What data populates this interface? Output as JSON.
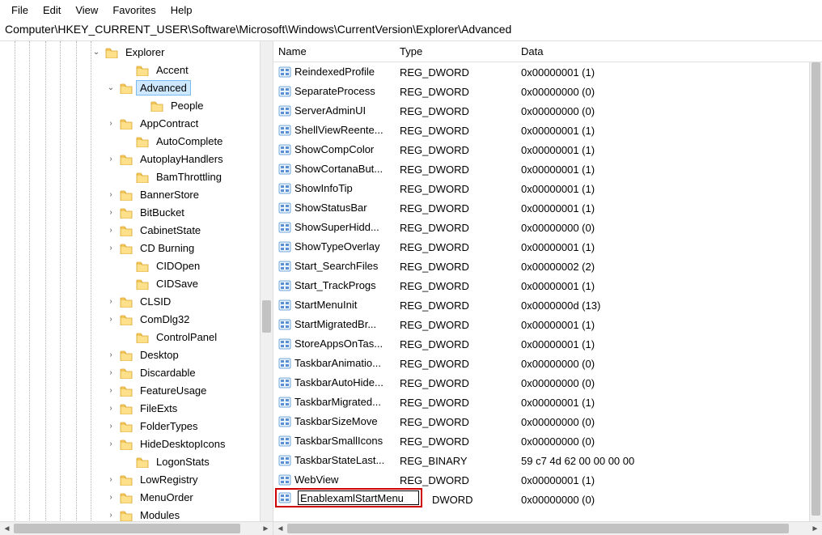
{
  "menu": {
    "items": [
      "File",
      "Edit",
      "View",
      "Favorites",
      "Help"
    ]
  },
  "address": "Computer\\HKEY_CURRENT_USER\\Software\\Microsoft\\Windows\\CurrentVersion\\Explorer\\Advanced",
  "tree": {
    "guides": [
      18,
      36,
      56,
      74,
      94,
      112
    ],
    "items": [
      {
        "indent": 112,
        "exp": "v",
        "label": "Explorer",
        "sel": false
      },
      {
        "indent": 150,
        "exp": "",
        "label": "Accent",
        "sel": false
      },
      {
        "indent": 130,
        "exp": "v",
        "label": "Advanced",
        "sel": true
      },
      {
        "indent": 168,
        "exp": "",
        "label": "People",
        "sel": false
      },
      {
        "indent": 130,
        "exp": ">",
        "label": "AppContract",
        "sel": false
      },
      {
        "indent": 150,
        "exp": "",
        "label": "AutoComplete",
        "sel": false
      },
      {
        "indent": 130,
        "exp": ">",
        "label": "AutoplayHandlers",
        "sel": false
      },
      {
        "indent": 150,
        "exp": "",
        "label": "BamThrottling",
        "sel": false
      },
      {
        "indent": 130,
        "exp": ">",
        "label": "BannerStore",
        "sel": false
      },
      {
        "indent": 130,
        "exp": ">",
        "label": "BitBucket",
        "sel": false
      },
      {
        "indent": 130,
        "exp": ">",
        "label": "CabinetState",
        "sel": false
      },
      {
        "indent": 130,
        "exp": ">",
        "label": "CD Burning",
        "sel": false
      },
      {
        "indent": 150,
        "exp": "",
        "label": "CIDOpen",
        "sel": false
      },
      {
        "indent": 150,
        "exp": "",
        "label": "CIDSave",
        "sel": false
      },
      {
        "indent": 130,
        "exp": ">",
        "label": "CLSID",
        "sel": false
      },
      {
        "indent": 130,
        "exp": ">",
        "label": "ComDlg32",
        "sel": false
      },
      {
        "indent": 150,
        "exp": "",
        "label": "ControlPanel",
        "sel": false
      },
      {
        "indent": 130,
        "exp": ">",
        "label": "Desktop",
        "sel": false
      },
      {
        "indent": 130,
        "exp": ">",
        "label": "Discardable",
        "sel": false
      },
      {
        "indent": 130,
        "exp": ">",
        "label": "FeatureUsage",
        "sel": false
      },
      {
        "indent": 130,
        "exp": ">",
        "label": "FileExts",
        "sel": false
      },
      {
        "indent": 130,
        "exp": ">",
        "label": "FolderTypes",
        "sel": false
      },
      {
        "indent": 130,
        "exp": ">",
        "label": "HideDesktopIcons",
        "sel": false
      },
      {
        "indent": 150,
        "exp": "",
        "label": "LogonStats",
        "sel": false
      },
      {
        "indent": 130,
        "exp": ">",
        "label": "LowRegistry",
        "sel": false
      },
      {
        "indent": 130,
        "exp": ">",
        "label": "MenuOrder",
        "sel": false
      },
      {
        "indent": 130,
        "exp": ">",
        "label": "Modules",
        "sel": false
      }
    ]
  },
  "columns": {
    "name": "Name",
    "type": "Type",
    "data": "Data"
  },
  "values": [
    {
      "name": "ReindexedProfile",
      "type": "REG_DWORD",
      "data": "0x00000001 (1)"
    },
    {
      "name": "SeparateProcess",
      "type": "REG_DWORD",
      "data": "0x00000000 (0)"
    },
    {
      "name": "ServerAdminUI",
      "type": "REG_DWORD",
      "data": "0x00000000 (0)"
    },
    {
      "name": "ShellViewReente...",
      "type": "REG_DWORD",
      "data": "0x00000001 (1)"
    },
    {
      "name": "ShowCompColor",
      "type": "REG_DWORD",
      "data": "0x00000001 (1)"
    },
    {
      "name": "ShowCortanaBut...",
      "type": "REG_DWORD",
      "data": "0x00000001 (1)"
    },
    {
      "name": "ShowInfoTip",
      "type": "REG_DWORD",
      "data": "0x00000001 (1)"
    },
    {
      "name": "ShowStatusBar",
      "type": "REG_DWORD",
      "data": "0x00000001 (1)"
    },
    {
      "name": "ShowSuperHidd...",
      "type": "REG_DWORD",
      "data": "0x00000000 (0)"
    },
    {
      "name": "ShowTypeOverlay",
      "type": "REG_DWORD",
      "data": "0x00000001 (1)"
    },
    {
      "name": "Start_SearchFiles",
      "type": "REG_DWORD",
      "data": "0x00000002 (2)"
    },
    {
      "name": "Start_TrackProgs",
      "type": "REG_DWORD",
      "data": "0x00000001 (1)"
    },
    {
      "name": "StartMenuInit",
      "type": "REG_DWORD",
      "data": "0x0000000d (13)"
    },
    {
      "name": "StartMigratedBr...",
      "type": "REG_DWORD",
      "data": "0x00000001 (1)"
    },
    {
      "name": "StoreAppsOnTas...",
      "type": "REG_DWORD",
      "data": "0x00000001 (1)"
    },
    {
      "name": "TaskbarAnimatio...",
      "type": "REG_DWORD",
      "data": "0x00000000 (0)"
    },
    {
      "name": "TaskbarAutoHide...",
      "type": "REG_DWORD",
      "data": "0x00000000 (0)"
    },
    {
      "name": "TaskbarMigrated...",
      "type": "REG_DWORD",
      "data": "0x00000001 (1)"
    },
    {
      "name": "TaskbarSizeMove",
      "type": "REG_DWORD",
      "data": "0x00000000 (0)"
    },
    {
      "name": "TaskbarSmallIcons",
      "type": "REG_DWORD",
      "data": "0x00000000 (0)"
    },
    {
      "name": "TaskbarStateLast...",
      "type": "REG_BINARY",
      "data": "59 c7 4d 62 00 00 00 00"
    },
    {
      "name": "WebView",
      "type": "REG_DWORD",
      "data": "0x00000001 (1)"
    }
  ],
  "edit_row": {
    "value": "EnablexamlStartMenu",
    "type": "DWORD",
    "data": "0x00000000 (0)"
  }
}
